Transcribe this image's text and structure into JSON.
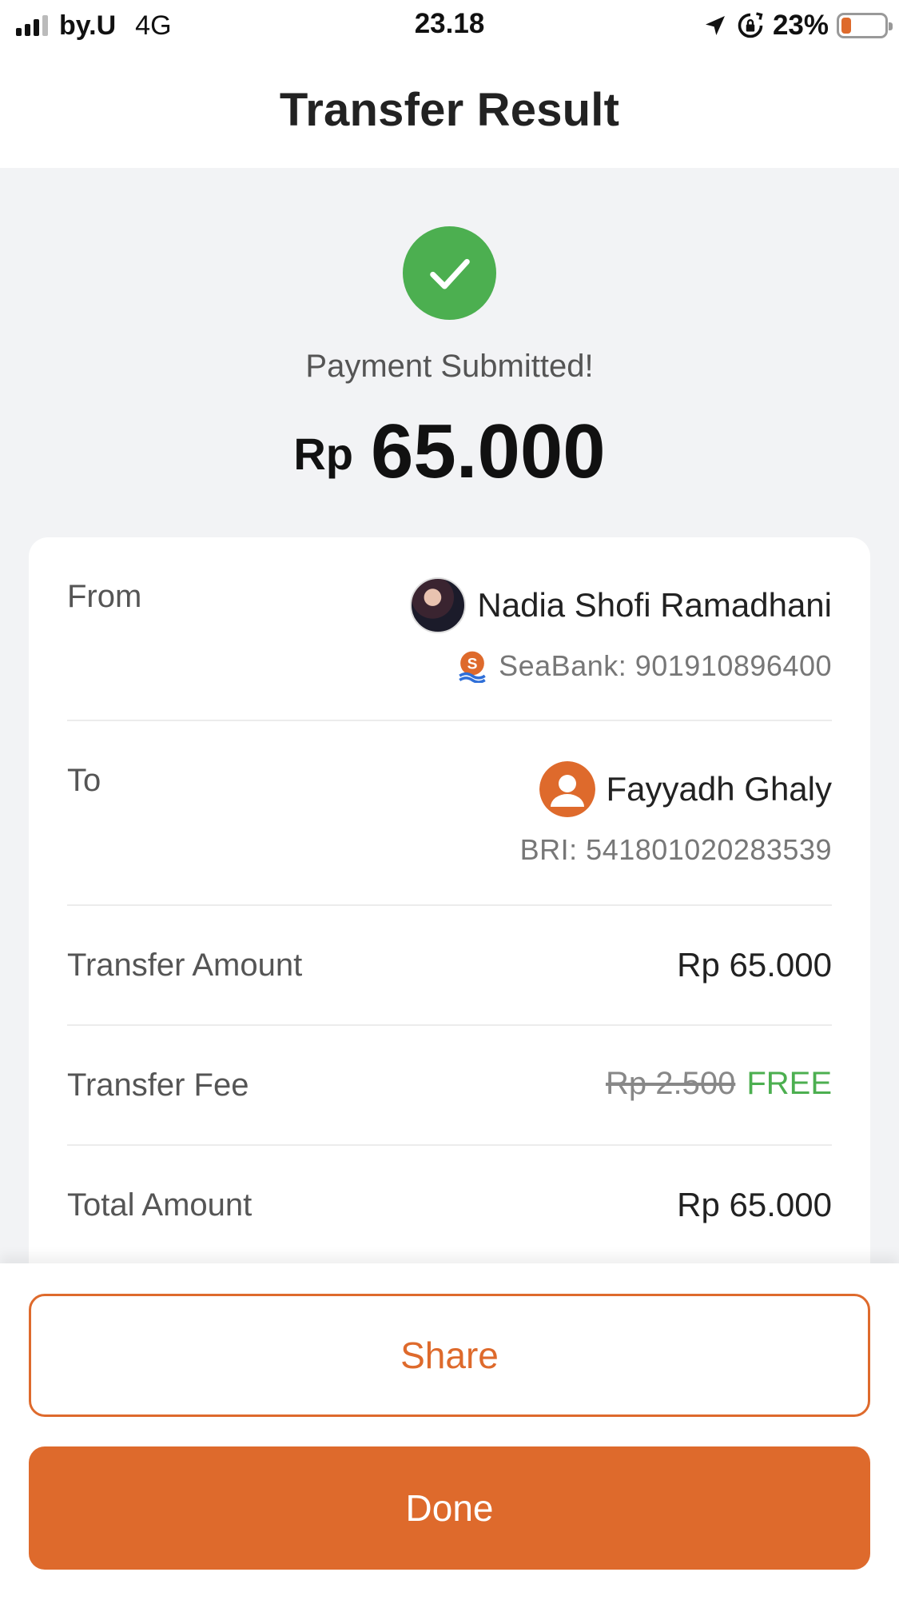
{
  "colors": {
    "accent": "#de6a2c",
    "success": "#4caf50",
    "battery_low": "#de6a2c",
    "free_green": "#4caf50"
  },
  "status_bar": {
    "carrier": "by.U",
    "network": "4G",
    "time": "23.18",
    "battery_percent": "23%",
    "battery_level": 0.23,
    "icons": [
      "signal-icon",
      "location-arrow-icon",
      "rotation-lock-icon",
      "battery-icon"
    ]
  },
  "header": {
    "title": "Transfer Result"
  },
  "result": {
    "icon": "check-circle-icon",
    "message": "Payment Submitted!",
    "currency": "Rp",
    "amount": "65.000"
  },
  "details": {
    "from": {
      "label": "From",
      "name": "Nadia Shofi Ramadhani",
      "avatar": "profile-photo",
      "bank_icon": "seabank-logo-icon",
      "account": "SeaBank: 901910896400"
    },
    "to": {
      "label": "To",
      "name": "Fayyadh Ghaly",
      "avatar": "user-placeholder-icon",
      "account": "BRI: 541801020283539"
    },
    "transfer_amount": {
      "label": "Transfer Amount",
      "value": "Rp 65.000"
    },
    "transfer_fee": {
      "label": "Transfer Fee",
      "original": "Rp 2.500",
      "value": "FREE"
    },
    "total_amount": {
      "label": "Total Amount",
      "value": "Rp 65.000"
    }
  },
  "actions": {
    "share_label": "Share",
    "done_label": "Done"
  }
}
